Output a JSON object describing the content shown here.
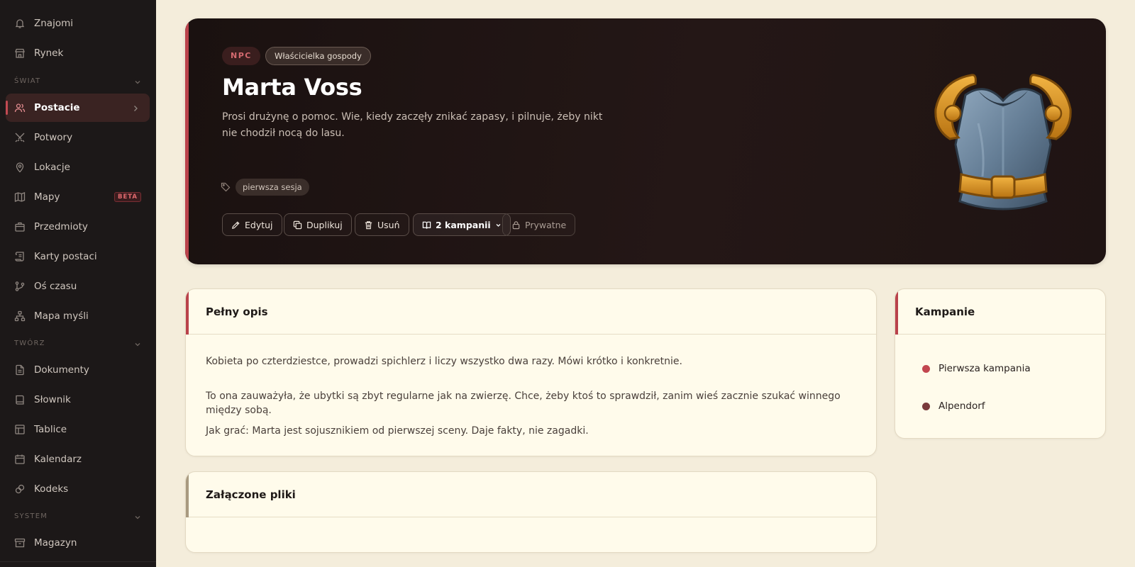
{
  "sidebar": {
    "top_items": [
      {
        "label": "Znajomi",
        "icon": "bell-icon"
      },
      {
        "label": "Rynek",
        "icon": "store-icon"
      }
    ],
    "sections": [
      {
        "label": "ŚWIAT",
        "items": [
          {
            "label": "Postacie",
            "icon": "users-icon",
            "active": true
          },
          {
            "label": "Potwory",
            "icon": "crossed-swords-icon"
          },
          {
            "label": "Lokacje",
            "icon": "map-pin-icon"
          },
          {
            "label": "Mapy",
            "icon": "map-icon",
            "badge": "BETA"
          },
          {
            "label": "Przedmioty",
            "icon": "package-icon"
          },
          {
            "label": "Karty postaci",
            "icon": "scroll-icon"
          },
          {
            "label": "Oś czasu",
            "icon": "git-branch-icon"
          },
          {
            "label": "Mapa myśli",
            "icon": "network-icon"
          }
        ]
      },
      {
        "label": "TWÓRZ",
        "items": [
          {
            "label": "Dokumenty",
            "icon": "file-icon"
          },
          {
            "label": "Słownik",
            "icon": "book-icon"
          },
          {
            "label": "Tablice",
            "icon": "table-icon"
          },
          {
            "label": "Kalendarz",
            "icon": "calendar-icon"
          },
          {
            "label": "Kodeks",
            "icon": "link-icon"
          }
        ]
      },
      {
        "label": "SYSTEM",
        "items": [
          {
            "label": "Magazyn",
            "icon": "archive-icon"
          }
        ]
      }
    ]
  },
  "hero": {
    "type_badge": "NPC",
    "role_badge": "Właścicielka gospody",
    "title": "Marta Voss",
    "description": "Prosi drużynę o pomoc. Wie, kiedy zaczęły znikać zapasy, i pilnuje, żeby nikt nie chodził nocą do lasu.",
    "tag": "pierwsza sesja",
    "actions": {
      "edit": "Edytuj",
      "duplicate": "Duplikuj",
      "delete": "Usuń",
      "campaigns": "2 kampanii",
      "visibility": "Prywatne"
    },
    "image_icon": "breastplate-armor-icon"
  },
  "description_card": {
    "title": "Pełny opis",
    "paragraphs": [
      "Kobieta po czterdziestce, prowadzi spichlerz i liczy wszystko dwa razy. Mówi krótko i konkretnie.",
      "To ona zauważyła, że ubytki są zbyt regularne jak na zwierzę. Chce, żeby ktoś to sprawdził, zanim wieś zacznie szukać winnego między sobą.",
      "Jak grać: Marta jest sojusznikiem od pierwszej sceny. Daje fakty, nie zagadki."
    ]
  },
  "files_card": {
    "title": "Załączone pliki"
  },
  "campaigns_card": {
    "title": "Kampanie",
    "items": [
      {
        "label": "Pierwsza kampania",
        "color": "#c2464f"
      },
      {
        "label": "Alpendorf",
        "color": "#7a3a3c"
      }
    ]
  },
  "colors": {
    "accent": "#b9424b",
    "sidebar_bg": "#1c1818",
    "page_bg": "#f4eddb"
  }
}
